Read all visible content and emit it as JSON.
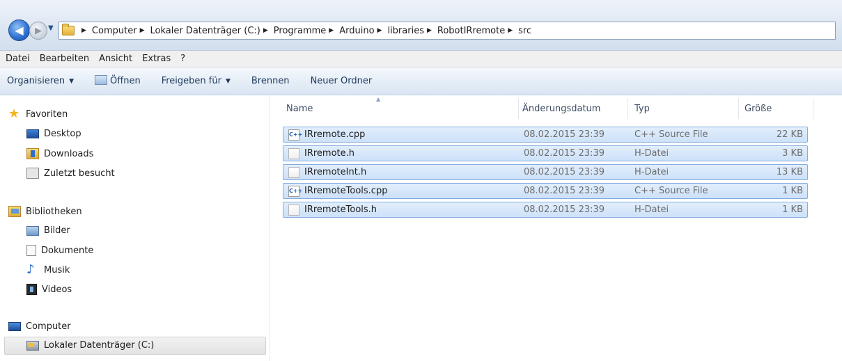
{
  "addressbar": {
    "crumbs": [
      "Computer",
      "Lokaler Datenträger (C:)",
      "Programme",
      "Arduino",
      "libraries",
      "RobotIRremote",
      "src"
    ]
  },
  "menu": [
    "Datei",
    "Bearbeiten",
    "Ansicht",
    "Extras",
    "?"
  ],
  "commands": {
    "organize": "Organisieren",
    "open": "Öffnen",
    "share": "Freigeben für",
    "burn": "Brennen",
    "new_folder": "Neuer Ordner"
  },
  "nav": {
    "favorites": "Favoriten",
    "desktop": "Desktop",
    "downloads": "Downloads",
    "recent": "Zuletzt besucht",
    "libraries": "Bibliotheken",
    "pictures": "Bilder",
    "documents": "Dokumente",
    "music": "Musik",
    "videos": "Videos",
    "computer": "Computer",
    "drive": "Lokaler Datenträger (C:)"
  },
  "columns": {
    "name": "Name",
    "date": "Änderungsdatum",
    "type": "Typ",
    "size": "Größe"
  },
  "files": [
    {
      "icon": "cpp-file-icon",
      "name": "IRremote.cpp",
      "date": "08.02.2015 23:39",
      "type": "C++ Source File",
      "size": "22 KB"
    },
    {
      "icon": "h-file-icon",
      "name": "IRremote.h",
      "date": "08.02.2015 23:39",
      "type": "H-Datei",
      "size": "3 KB"
    },
    {
      "icon": "h-file-icon",
      "name": "IRremoteInt.h",
      "date": "08.02.2015 23:39",
      "type": "H-Datei",
      "size": "13 KB"
    },
    {
      "icon": "cpp-file-icon",
      "name": "IRremoteTools.cpp",
      "date": "08.02.2015 23:39",
      "type": "C++ Source File",
      "size": "1 KB"
    },
    {
      "icon": "h-file-icon",
      "name": "IRremoteTools.h",
      "date": "08.02.2015 23:39",
      "type": "H-Datei",
      "size": "1 KB"
    }
  ]
}
